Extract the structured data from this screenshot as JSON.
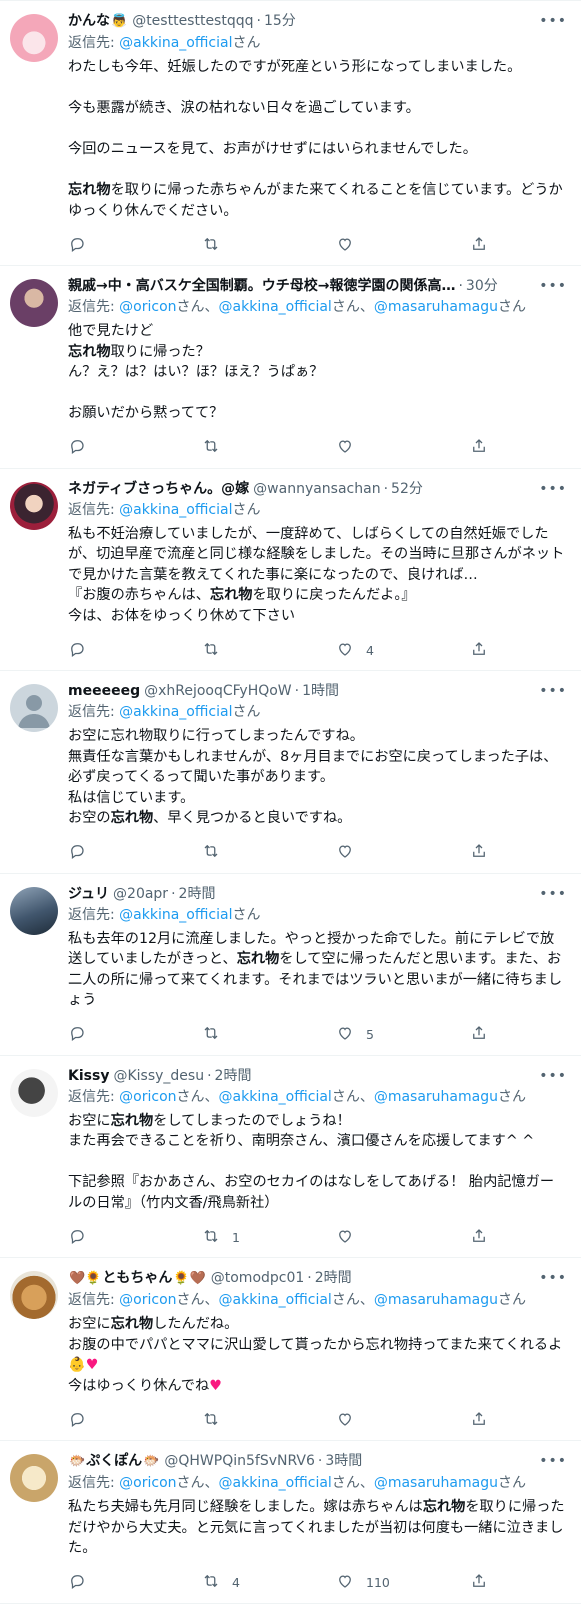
{
  "labels": {
    "reply_prefix": "返信先:",
    "san": "さん"
  },
  "icons": {
    "more": "more-horizontal-icon",
    "reply": "reply-bubble-icon",
    "retweet": "retweet-icon",
    "like": "like-heart-icon",
    "share": "share-icon"
  },
  "colors": {
    "mention": "#1d9bf0",
    "secondary_text": "#536471",
    "heart": "#f91880"
  },
  "tweets": [
    {
      "name": "かんな",
      "name_emoji": "👼",
      "handle": "@testtesttestqqq",
      "time": "15分",
      "reply_to": [
        "@akkina_official"
      ],
      "body": [
        {
          "t": "わたしも今年、妊娠したのですが死産という形になってしまいました。\n\n今も悪露が続き、涙の枯れない日々を過ごしています。\n\n今回のニュースを見て、お声がけせずにはいられませんでした。\n\n"
        },
        {
          "t": "忘れ物",
          "b": true
        },
        {
          "t": "を取りに帰った赤ちゃんがまた来てくれることを信じています。どうかゆっくり休んでください。"
        }
      ],
      "counts": {
        "reply": "",
        "retweet": "",
        "like": ""
      }
    },
    {
      "name": "親戚→中・高バスケ全国制覇。ウチ母校→報徳学園の関係高…",
      "handle": "",
      "time": "30分",
      "reply_to": [
        "@oricon",
        "@akkina_official",
        "@masaruhamagu"
      ],
      "body": [
        {
          "t": "他で見たけど\n"
        },
        {
          "t": "忘れ物",
          "b": true
        },
        {
          "t": "取りに帰った？\nん？え？は？はい？ほ？ほえ？うぱぁ？\n\nお願いだから黙ってて？"
        }
      ],
      "counts": {
        "reply": "",
        "retweet": "",
        "like": ""
      }
    },
    {
      "name": "ネガティブさっちゃん。@嫁",
      "handle": "@wannyansachan",
      "time": "52分",
      "reply_to": [
        "@akkina_official"
      ],
      "body": [
        {
          "t": "私も不妊治療していましたが、一度辞めて、しばらくしての自然妊娠でしたが、切迫早産で流産と同じ様な経験をしました。その当時に旦那さんがネットで見かけた言葉を教えてくれた事に楽になったので、良ければ…\n『お腹の赤ちゃんは、"
        },
        {
          "t": "忘れ物",
          "b": true
        },
        {
          "t": "を取りに戻ったんだよ。』\n今は、お体をゆっくり休めて下さい"
        }
      ],
      "counts": {
        "reply": "",
        "retweet": "",
        "like": "4"
      }
    },
    {
      "name": "meeeeeg",
      "handle": "@xhRejooqCFyHQoW",
      "time": "1時間",
      "reply_to": [
        "@akkina_official"
      ],
      "body": [
        {
          "t": "お空に忘れ物取りに行ってしまったんですね。\n無責任な言葉かもしれませんが、8ヶ月目までにお空に戻ってしまった子は、必ず戻ってくるって聞いた事があります。\n私は信じています。\nお空の"
        },
        {
          "t": "忘れ物",
          "b": true
        },
        {
          "t": "、早く見つかると良いですね。"
        }
      ],
      "counts": {
        "reply": "",
        "retweet": "",
        "like": ""
      }
    },
    {
      "name": "ジュリ",
      "handle": "@20apr",
      "time": "2時間",
      "reply_to": [
        "@akkina_official"
      ],
      "body": [
        {
          "t": "私も去年の12月に流産しました。やっと授かった命でした。前にテレビで放送していましたがきっと、"
        },
        {
          "t": "忘れ物",
          "b": true
        },
        {
          "t": "をして空に帰ったんだと思います。また、お二人の所に帰って来てくれます。それまではツラいと思いまが一緒に待ちましょう"
        }
      ],
      "counts": {
        "reply": "",
        "retweet": "",
        "like": "5"
      }
    },
    {
      "name": "Kissy",
      "handle": "@Kissy_desu",
      "time": "2時間",
      "reply_to": [
        "@oricon",
        "@akkina_official",
        "@masaruhamagu"
      ],
      "body": [
        {
          "t": "お空に"
        },
        {
          "t": "忘れ物",
          "b": true
        },
        {
          "t": "をしてしまったのでしょうね！\nまた再会できることを祈り、南明奈さん、濱口優さんを応援してます^ ^\n\n下記参照『おかあさん、お空のセカイのはなしをしてあげる！ 胎内記憶ガールの日常』（竹内文香/飛鳥新社）"
        }
      ],
      "counts": {
        "reply": "",
        "retweet": "1",
        "like": ""
      }
    },
    {
      "name": "ともちゃん",
      "name_emoji_pre": "🤎🌻",
      "name_emoji": "🌻🤎",
      "handle": "@tomodpc01",
      "time": "2時間",
      "reply_to": [
        "@oricon",
        "@akkina_official",
        "@masaruhamagu"
      ],
      "body": [
        {
          "t": "お空に"
        },
        {
          "t": "忘れ物",
          "b": true
        },
        {
          "t": "したんだね。\nお腹の中でパパとママに沢山愛して貰ったから忘れ物持ってまた来てくれるよ👶"
        },
        {
          "t": "♥",
          "h": true
        },
        {
          "t": "\n今はゆっくり休んでね"
        },
        {
          "t": "♥",
          "h": true
        }
      ],
      "counts": {
        "reply": "",
        "retweet": "",
        "like": ""
      }
    },
    {
      "name": "ぷくぽん",
      "name_emoji_pre": "🐡",
      "name_emoji": "🐡",
      "handle": "@QHWPQin5fSvNRV6",
      "time": "3時間",
      "reply_to": [
        "@oricon",
        "@akkina_official",
        "@masaruhamagu"
      ],
      "body": [
        {
          "t": "私たち夫婦も先月同じ経験をしました。嫁は赤ちゃんは"
        },
        {
          "t": "忘れ物",
          "b": true
        },
        {
          "t": "を取りに帰っただけやから大丈夫。と元気に言ってくれましたが当初は何度も一緒に泣きました。"
        }
      ],
      "counts": {
        "reply": "",
        "retweet": "4",
        "like": "110"
      }
    }
  ]
}
